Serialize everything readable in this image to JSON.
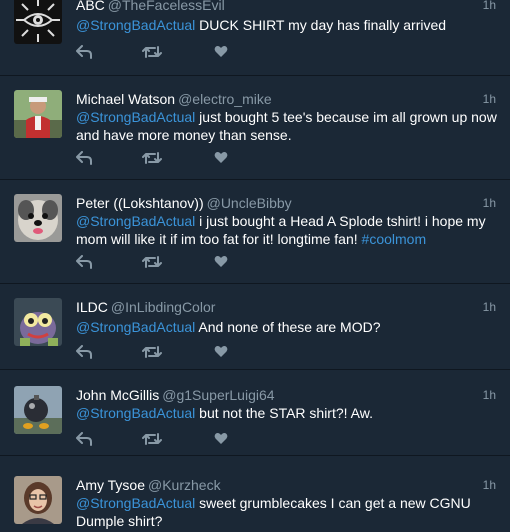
{
  "colors": {
    "background": "#1b2836",
    "link": "#3b94d9",
    "muted": "#8899a6",
    "divider": "#0f1720"
  },
  "tweets": [
    {
      "name": "ABC",
      "handle": "@TheFacelessEvil",
      "time": "1h",
      "mention": "@StrongBadActual",
      "text": " DUCK SHIRT my day has finally arrived",
      "hashtag": "",
      "avatar_icon": "eye-sigil-avatar"
    },
    {
      "name": "Michael Watson",
      "handle": "@electro_mike",
      "time": "1h",
      "mention": "@StrongBadActual",
      "text": " just bought 5 tee's because im all grown up now and have more money than sense.",
      "hashtag": "",
      "avatar_icon": "person-photo-avatar"
    },
    {
      "name": "Peter ((Lokshtanov))",
      "handle": "@UncleBibby",
      "time": "1h",
      "mention": "@StrongBadActual",
      "text": " i just bought a Head A Splode tshirt! i hope my mom will like it if im too fat for it! longtime fan! ",
      "hashtag": "#coolmom",
      "avatar_icon": "dog-photo-avatar"
    },
    {
      "name": "ILDC",
      "handle": "@InLibdingColor",
      "time": "1h",
      "mention": "@StrongBadActual",
      "text": " And none of these are MOD?",
      "hashtag": "",
      "avatar_icon": "creature-avatar"
    },
    {
      "name": "John McGillis",
      "handle": "@g1SuperLuigi64",
      "time": "1h",
      "mention": "@StrongBadActual",
      "text": " but not the STAR shirt?! Aw.",
      "hashtag": "",
      "avatar_icon": "bomb-avatar"
    },
    {
      "name": "Amy Tysoe",
      "handle": "@Kurzheck",
      "time": "1h",
      "mention": "@StrongBadActual",
      "text": " sweet grumblecakes I can get a new CGNU Dumple shirt?",
      "hashtag": "",
      "avatar_icon": "woman-photo-avatar"
    }
  ],
  "action_icons": [
    "reply-icon",
    "retweet-icon",
    "like-icon"
  ]
}
